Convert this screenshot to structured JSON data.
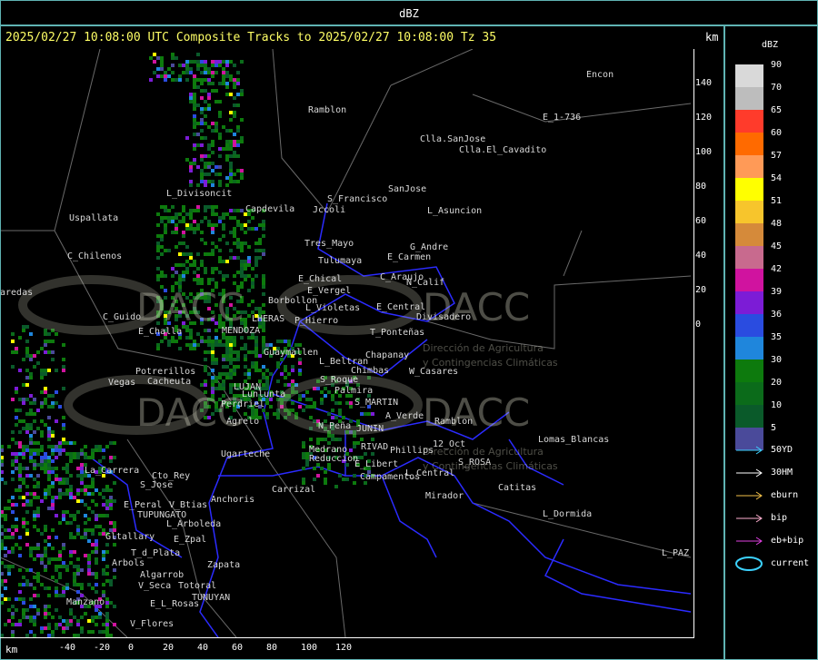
{
  "window_title": "dBZ",
  "header": {
    "text": "2025/02/27 10:08:00 UTC Composite Tracks to 2025/02/27 10:08:00 Tz 35",
    "unit": "km"
  },
  "legend": {
    "title": "dBZ",
    "bins": [
      {
        "label": "90",
        "color": "#d9d9d9"
      },
      {
        "label": "70",
        "color": "#bdbdbd"
      },
      {
        "label": "65",
        "color": "#ff3b2b"
      },
      {
        "label": "60",
        "color": "#ff6a00"
      },
      {
        "label": "57",
        "color": "#ff9a57"
      },
      {
        "label": "54",
        "color": "#ffff00"
      },
      {
        "label": "51",
        "color": "#f7c52c"
      },
      {
        "label": "48",
        "color": "#d58a3a"
      },
      {
        "label": "45",
        "color": "#c86a8e"
      },
      {
        "label": "42",
        "color": "#d0139f"
      },
      {
        "label": "39",
        "color": "#7c1cd6"
      },
      {
        "label": "36",
        "color": "#2a4ce0"
      },
      {
        "label": "35",
        "color": "#1f86dc"
      },
      {
        "label": "30",
        "color": "#0d7a0d"
      },
      {
        "label": "20",
        "color": "#0b6b1a"
      },
      {
        "label": "10",
        "color": "#0a5a2a"
      },
      {
        "label": "5",
        "color": "#4a4a9a"
      }
    ],
    "tracks": [
      {
        "label": "50YD",
        "color": "#3cd2ff",
        "icon": "arrow-icon"
      },
      {
        "label": "30HM",
        "color": "#ffffff",
        "icon": "arrow-icon"
      },
      {
        "label": "eburn",
        "color": "#f5c24a",
        "icon": "arrow-icon"
      },
      {
        "label": "bip",
        "color": "#ffb0d0",
        "icon": "arrow-icon"
      },
      {
        "label": "eb+bip",
        "color": "#e040e0",
        "icon": "arrow-icon"
      },
      {
        "label": "current",
        "color": "#3cd2ff",
        "icon": "ellipse-icon"
      }
    ]
  },
  "axes": {
    "y_ticks": [
      "140",
      "120",
      "100",
      "80",
      "60",
      "40",
      "20",
      "0"
    ],
    "x_ticks": [
      "-40",
      "-20",
      "0",
      "20",
      "40",
      "60",
      "80",
      "100",
      "120"
    ],
    "x_unit": "km"
  },
  "watermark": {
    "brand": "DACC",
    "line1": "Dirección de Agricultura",
    "line2": "y Contingencias Climáticas"
  },
  "places": [
    "Ramblon",
    "Encon",
    "E_1-736",
    "Clla.SanJose",
    "Clla.El_Cavadito",
    "SanJose",
    "S_Francisco",
    "Jccoli",
    "L_Asuncion",
    "Uspallata",
    "L_Divisoncit",
    "Capdevila",
    "Tres_Mayo",
    "G_Andre",
    "Tulumaya",
    "E_Carmen",
    "C_Chilenos",
    "E_Chical",
    "C_Araujo",
    "N_Calif",
    "E_Vergel",
    "Borbollon",
    "E_Central",
    "Divisadero",
    "L_Violetas",
    "P_Hierro",
    "C_Guido",
    "E_Challa",
    "MENDOZA",
    "LHERAS",
    "Guaymallen",
    "T_Ponteñas",
    "Chapanay",
    "L_Beltran",
    "W_Casares",
    "Chimbas",
    "Potrerillos",
    "Cacheuta",
    "Vegas",
    "LUJAN",
    "Lunlunta",
    "S_Roque",
    "Palmira",
    "S_MARTIN",
    "Perdriel",
    "Agrelo",
    "A_Verde",
    "Ramblon",
    "N_Peña",
    "JUNIN",
    "RIVAD",
    "Phillips",
    "12_Oct",
    "Ugarteche",
    "Medrano",
    "Reduccion",
    "E_Libert",
    "S_ROSA",
    "Lomas_Blancas",
    "La_Carrera",
    "Cto_Rey",
    "Campamentos",
    "L_Central",
    "Carrizal",
    "S_Jose",
    "Mirador",
    "Catitas",
    "E_Peral",
    "V_Btias",
    "Anchoris",
    "TUPUNGATO",
    "L_Dormida",
    "L_Arboleda",
    "Gltallary",
    "E_Zpal",
    "L_PAZ",
    "T_d_Plata",
    "Arbols",
    "Zapata",
    "Algarrob",
    "Totoral",
    "V_Seca",
    "Manzano",
    "E_L_Rosas",
    "TUNUYAN",
    "V_Flores",
    "aredas"
  ]
}
